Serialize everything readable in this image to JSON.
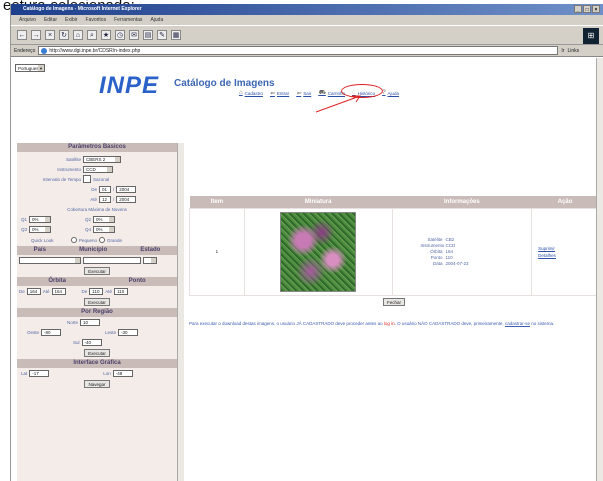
{
  "caption": "eetura-selecionada:",
  "window": {
    "title": "Catálogo de Imagens - Microsoft Internet Explorer",
    "menu": [
      "Arquivo",
      "Editar",
      "Exibir",
      "Favoritos",
      "Ferramentas",
      "Ajuda"
    ],
    "address_label": "Endereço",
    "address": "http://www.dgi.inpe.br/CDSR/n-index.php",
    "go_label": "Ir",
    "links_label": "Links"
  },
  "page": {
    "language": "Portugues",
    "logo": "INPE",
    "title": "Catálogo de Imagens",
    "nav": [
      {
        "icon": "home-icon",
        "label": "Cadastro"
      },
      {
        "icon": "enter-icon",
        "label": "Entrar"
      },
      {
        "icon": "exit-icon",
        "label": "Sair"
      },
      {
        "icon": "cart-icon",
        "label": "Carrinho"
      },
      {
        "icon": "history-icon",
        "label": "Histórico"
      },
      {
        "icon": "help-icon",
        "label": "Ajuda"
      }
    ]
  },
  "sidebar": {
    "basic_title": "Parâmetros Básicos",
    "satellite_label": "Satélite",
    "satellite_value": "CBERS 2",
    "instrument_label": "Instrumento",
    "instrument_value": "CCD",
    "interval_label": "Intervalo de Tempo",
    "seasonal_label": "Sazonal",
    "from_label": "De",
    "from_month": "01",
    "from_year": "2004",
    "to_label": "Até",
    "to_month": "12",
    "to_year": "2004",
    "cloud_title": "Cobertura Máxima de Nuvens",
    "q1_label": "Q1",
    "q1_value": "0%",
    "q2_label": "Q2",
    "q2_value": "0%",
    "q3_label": "Q3",
    "q3_value": "0%",
    "q4_label": "Q4",
    "q4_value": "0%",
    "quicklook_label": "Quick Look",
    "small_label": "Pequeno",
    "large_label": "Grande",
    "country_label": "País",
    "city_label": "Município",
    "state_label": "Estado",
    "search_label": "Executar",
    "orbit_title": "Órbita",
    "point_title": "Ponto",
    "orbit_from_label": "De",
    "orbit_from": "164",
    "orbit_to_label": "Até",
    "orbit_to": "164",
    "point_from_label": "De",
    "point_from": "110",
    "point_to_label": "Até",
    "point_to": "110",
    "region_title": "Por Região",
    "north_label": "Norte",
    "north": "10",
    "west_label": "Oeste",
    "west": "-80",
    "east_label": "Leste",
    "east": "-30",
    "south_label": "Sul",
    "south": "-40",
    "graphic_title": "Interface Gráfica",
    "lat_label": "Lat",
    "lat": "-17",
    "lon_label": "Lon",
    "lon": "-48",
    "navigate_label": "Navegar"
  },
  "results": {
    "headers": [
      "Item",
      "Miniatura",
      "Informações",
      "Ação"
    ],
    "item": "1",
    "info": [
      {
        "k": "Satélite",
        "v": "CB2"
      },
      {
        "k": "Instrumento",
        "v": "CCD"
      },
      {
        "k": "Órbita",
        "v": "164"
      },
      {
        "k": "Ponto",
        "v": "110"
      },
      {
        "k": "Data",
        "v": "2004-07-23"
      }
    ],
    "actions": [
      "Suprimir",
      "Detalhes"
    ],
    "close_label": "Fechar",
    "footer_a": "Para executar o download destas imagens, o usuário JÁ CADASTRADO deve proceder antes ao",
    "footer_login": "log in",
    "footer_b": ". O usuário NÃO CADASTRADO deve, primeiramente,",
    "footer_link": "cadastrar-se",
    "footer_c": "no sistema."
  }
}
